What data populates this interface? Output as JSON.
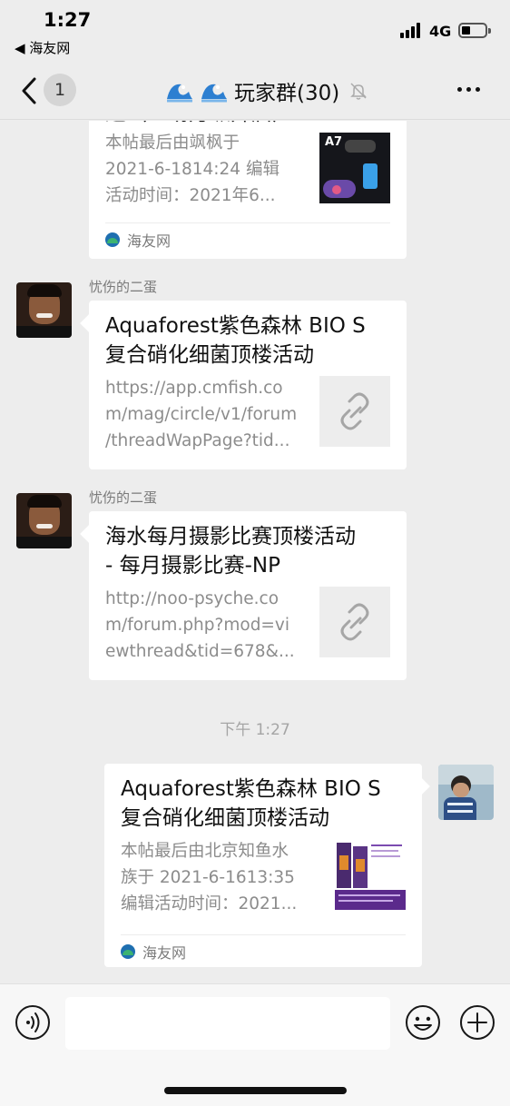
{
  "status_bar": {
    "time": "1:27",
    "back_app": "◀ 海友网",
    "network": "4G",
    "battery_level": 0.25
  },
  "nav": {
    "unread_count": "1",
    "title": "玩家群(30)"
  },
  "messages": [
    {
      "type": "link-card",
      "partial": true,
      "title_partial": "适（一场万纵开启）",
      "desc_lines": [
        "本帖最后由飒枫于",
        "2021-6-1814:24 编辑",
        "活动时间：2021年6..."
      ],
      "thumb_label": "A7",
      "source": "海友网"
    },
    {
      "type": "link-card",
      "sender": "忧伤的二蛋",
      "title_lines": [
        "Aquaforest紫色森林 BIO S",
        "复合硝化细菌顶楼活动"
      ],
      "desc_lines": [
        "https://app.cmfish.co",
        "m/mag/circle/v1/forum",
        "/threadWapPage?tid..."
      ],
      "thumb_icon": "link-icon"
    },
    {
      "type": "link-card",
      "sender": "忧伤的二蛋",
      "title_lines": [
        "海水每月摄影比赛顶楼活动",
        "- 每月摄影比赛-NP"
      ],
      "desc_lines": [
        "http://noo-psyche.co",
        "m/forum.php?mod=vi",
        "ewthread&tid=678&..."
      ],
      "thumb_icon": "link-icon"
    },
    {
      "type": "timestamp",
      "text": "下午 1:27"
    },
    {
      "type": "link-card",
      "own": true,
      "title_lines": [
        "Aquaforest紫色森林 BIO S",
        "复合硝化细菌顶楼活动"
      ],
      "desc_lines": [
        "本帖最后由北京知鱼水",
        "族于 2021-6-1613:35",
        "编辑活动时间：2021..."
      ],
      "source": "海友网"
    }
  ],
  "icons": {
    "back": "chevron-left-icon",
    "group": "wave-icon",
    "mute": "bell-off-icon",
    "more": "more-icon",
    "voice": "voice-icon",
    "emoji": "emoji-icon",
    "plus": "plus-icon"
  }
}
